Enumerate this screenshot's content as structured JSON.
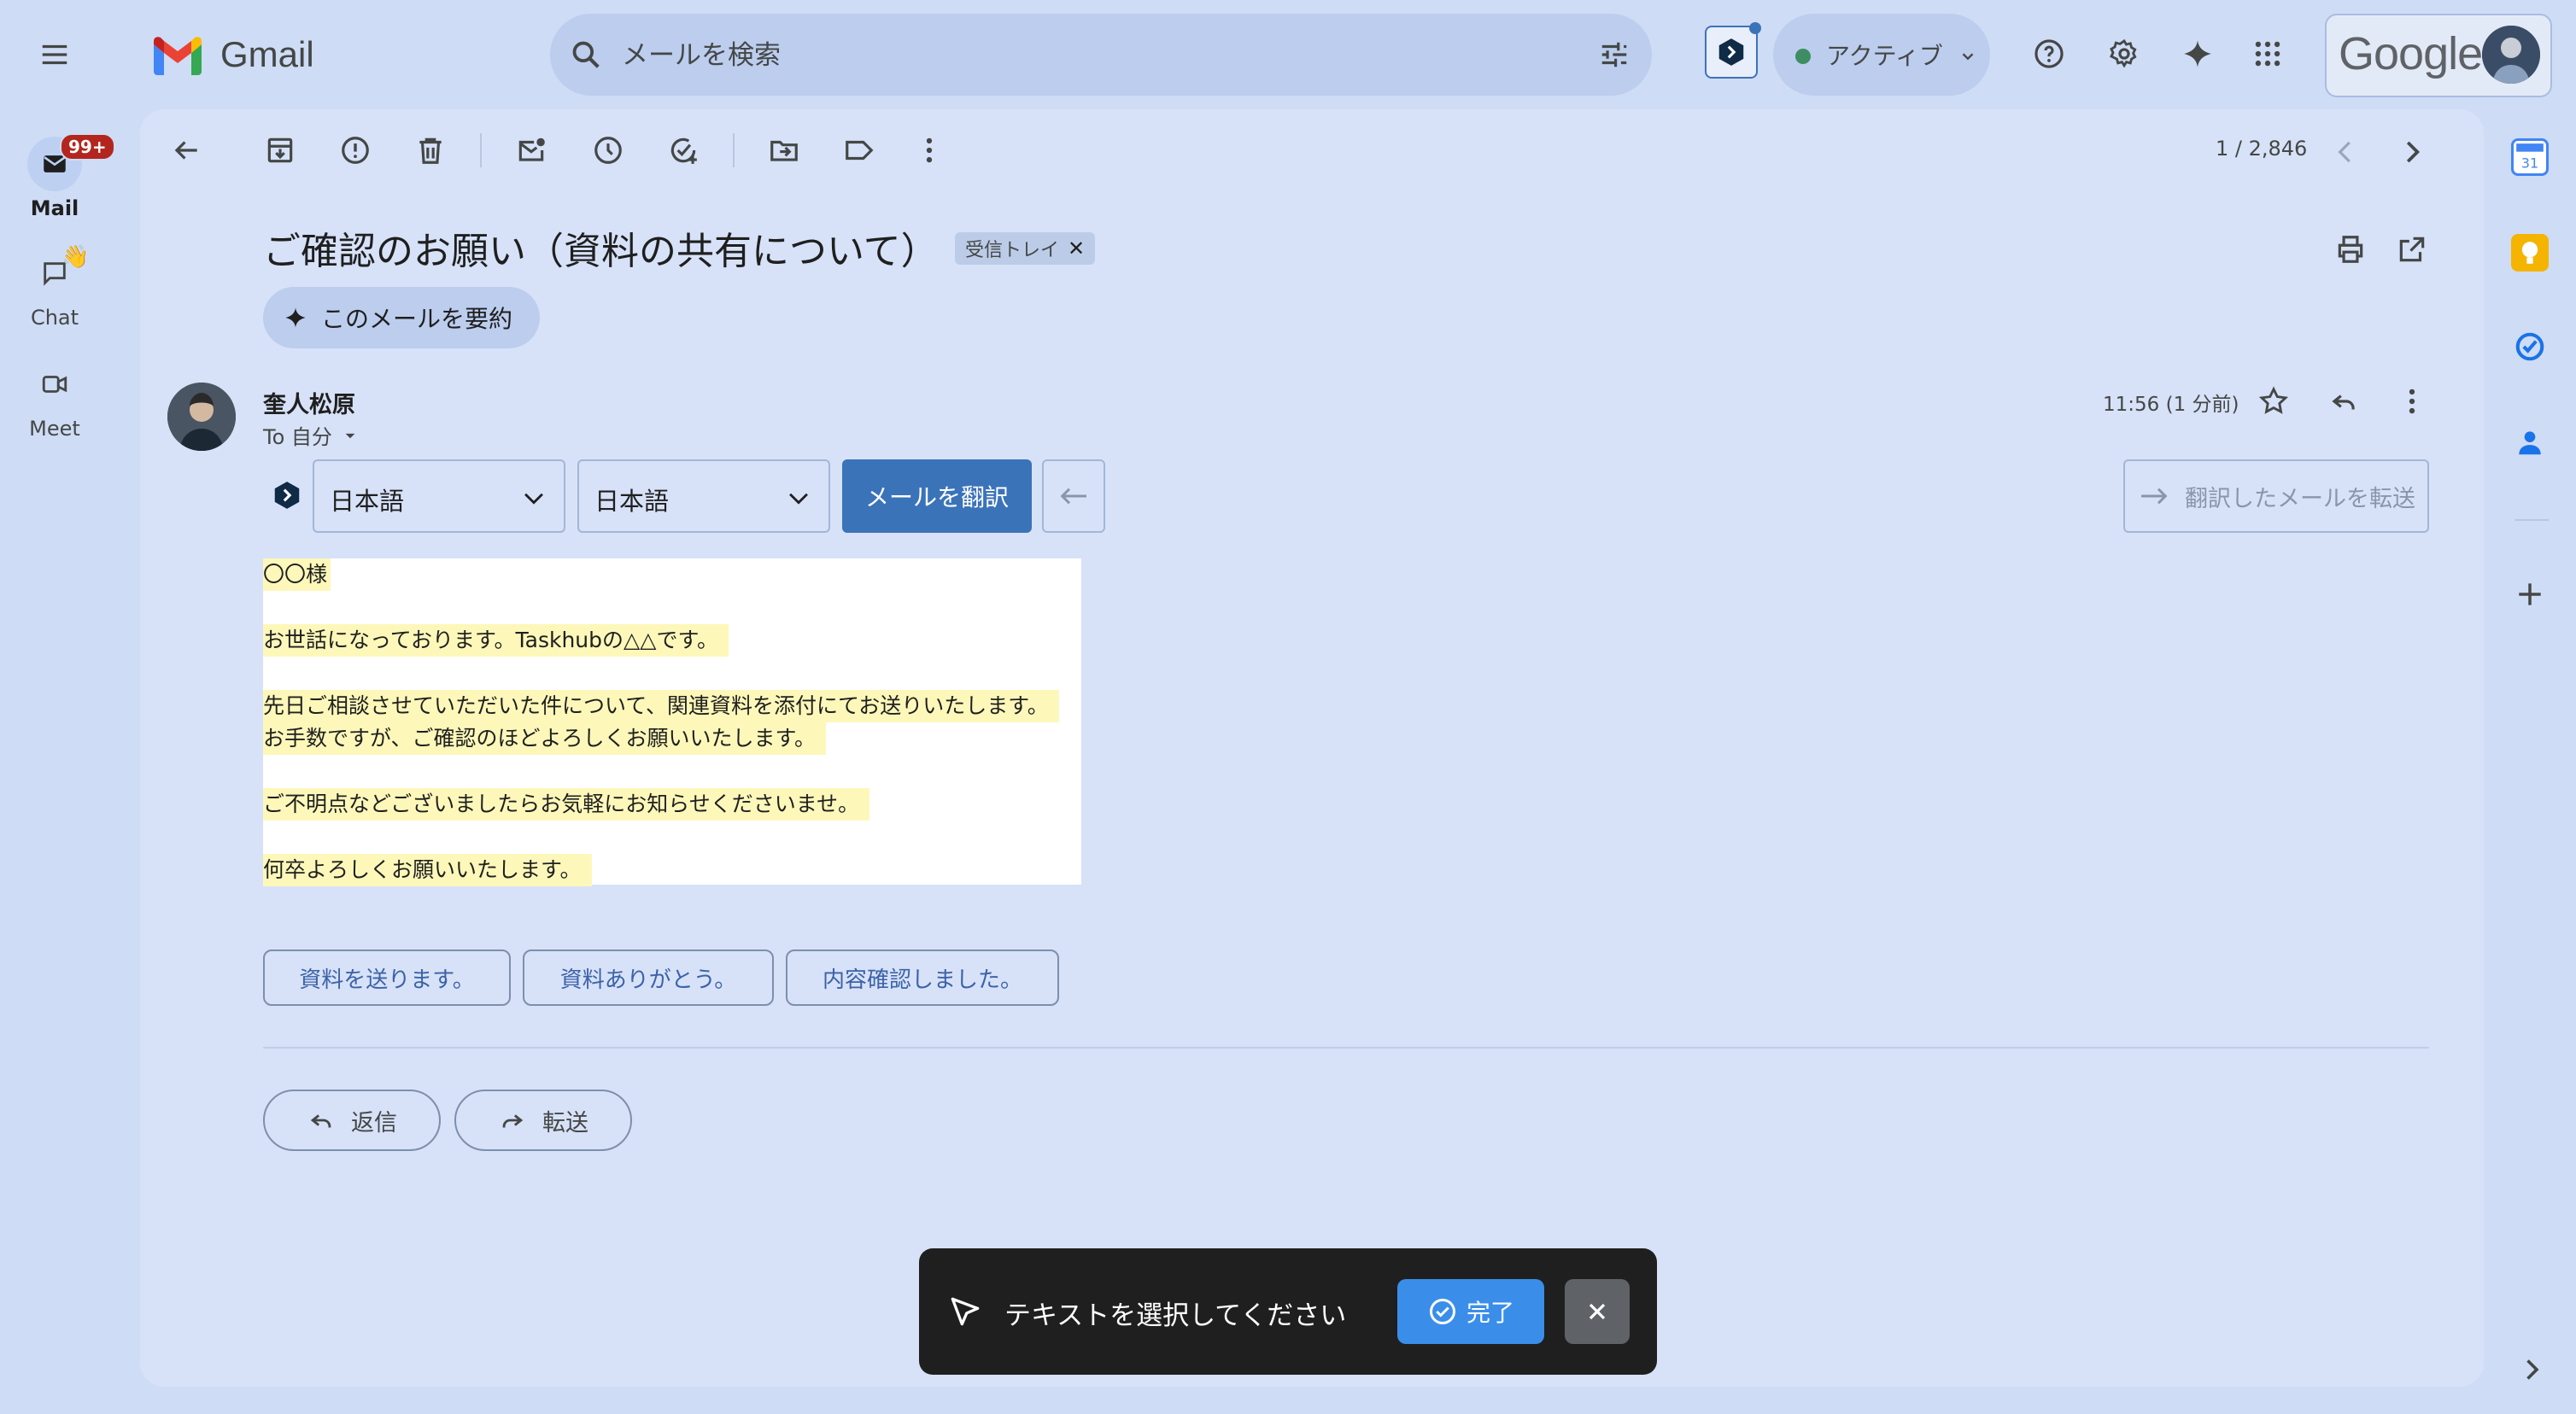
{
  "app": {
    "name": "Gmail",
    "brand": "Google"
  },
  "search": {
    "placeholder": "メールを検索"
  },
  "status": {
    "label": "アクティブ",
    "color": "#3f8d63"
  },
  "nav": {
    "mail": {
      "label": "Mail",
      "badge": "99+"
    },
    "chat": {
      "label": "Chat"
    },
    "meet": {
      "label": "Meet"
    }
  },
  "toolbar": {
    "pagination": "1 / 2,846"
  },
  "email": {
    "subject": "ご確認のお願い（資料の共有について）",
    "label_chip": "受信トレイ",
    "summarize": "このメールを要約",
    "sender": "奎人松原",
    "to": "To 自分",
    "time": "11:56 (1 分前)",
    "body_lines": [
      "〇〇様",
      "お世話になっております。Taskhubの△△です。",
      "先日ご相談させていただいた件について、関連資料を添付にてお送りいたします。",
      "お手数ですが、ご確認のほどよろしくお願いいたします。",
      "ご不明点などございましたらお気軽にお知らせくださいませ。",
      "何卒よろしくお願いいたします。"
    ]
  },
  "translator": {
    "source_lang": "日本語",
    "target_lang": "日本語",
    "translate_button": "メールを翻訳",
    "forward_translated": "翻訳したメールを転送"
  },
  "smart_replies": [
    "資料を送ります。",
    "資料ありがとう。",
    "内容確認しました。"
  ],
  "actions": {
    "reply": "返信",
    "forward": "転送"
  },
  "toast": {
    "message": "テキストを選択してください",
    "done": "完了"
  },
  "colors": {
    "accent": "#3b73b9",
    "highlight": "#fdf8ba",
    "toast_button": "#3a8eea",
    "badge": "#b3261e"
  }
}
